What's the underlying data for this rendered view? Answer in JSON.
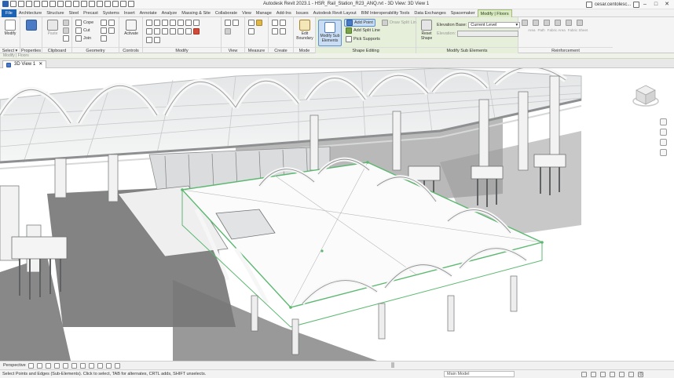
{
  "app": {
    "title": "Autodesk Revit 2023.1 - HSR_Rail_Station_R23_ANQ.rvt - 3D View: 3D View 1",
    "user": "cesar.centolesc..."
  },
  "window_controls": [
    "–",
    "□",
    "✕"
  ],
  "ribbon_tabs": [
    {
      "label": "File",
      "kind": "file"
    },
    {
      "label": "Architecture"
    },
    {
      "label": "Structure"
    },
    {
      "label": "Steel"
    },
    {
      "label": "Precast"
    },
    {
      "label": "Systems"
    },
    {
      "label": "Insert"
    },
    {
      "label": "Annotate"
    },
    {
      "label": "Analyze"
    },
    {
      "label": "Massing & Site"
    },
    {
      "label": "Collaborate"
    },
    {
      "label": "View"
    },
    {
      "label": "Manage"
    },
    {
      "label": "Add-Ins"
    },
    {
      "label": "Issues"
    },
    {
      "label": "Autodesk Revit Layout"
    },
    {
      "label": "BIM Interoperability Tools"
    },
    {
      "label": "Data Exchanges"
    },
    {
      "label": "Spacemaker"
    },
    {
      "label": "Modify | Floors",
      "kind": "ctx"
    }
  ],
  "ribbon": {
    "select": {
      "label": "Select ▾",
      "modify": "Modify"
    },
    "properties": {
      "label": "Properties"
    },
    "clipboard": {
      "label": "Clipboard",
      "paste": "Paste"
    },
    "geometry": {
      "label": "Geometry",
      "cope": "Cope",
      "cut": "Cut",
      "join": "Join"
    },
    "controls": {
      "label": "Controls",
      "activate": "Activate"
    },
    "modify": {
      "label": "Modify"
    },
    "view": {
      "label": "View"
    },
    "measure": {
      "label": "Measure"
    },
    "create": {
      "label": "Create"
    },
    "mode": {
      "label": "Mode",
      "edit_boundary": "Edit Boundary"
    },
    "shape_editing": {
      "label": "Shape Editing",
      "modify_sub": "Modify Sub Elements",
      "add_point": "Add Point",
      "add_split_line": "Add Split Line",
      "pick_supports": "Pick Supports",
      "draw_split": "Draw Split Lines"
    },
    "sub_elements": {
      "label": "Modify Sub Elements",
      "reset_shape": "Reset Shape",
      "elevation_base_label": "Elevation Base:",
      "elevation_base_value": "Current Level",
      "elevation_label": "Elevation:"
    },
    "reinforcement": {
      "label": "Reinforcement",
      "items": [
        "Area",
        "Path",
        "Fabric Area",
        "Fabric Sheet"
      ]
    }
  },
  "options_bar": {
    "text": "Modify | Floors"
  },
  "view_tab": {
    "label": "3D View 1",
    "close": "✕"
  },
  "view_control": {
    "label": "Perspective"
  },
  "status": {
    "text": "Select Points and Edges (Sub-Elements). Click to select, TAB for alternates, CRTL adds, SHIFT unselects.",
    "model": "Main Model",
    "select_count": ":0"
  },
  "colors": {
    "file_tab": "#1e64b4",
    "context_tab": "#dbe9c6",
    "edit_highlight": "#5cb870"
  },
  "icons": {
    "viewcube": "viewcube-icon",
    "nav_wheel": "steering-wheel-icon",
    "zoom": "zoom-icon",
    "filter": "filter-icon"
  }
}
